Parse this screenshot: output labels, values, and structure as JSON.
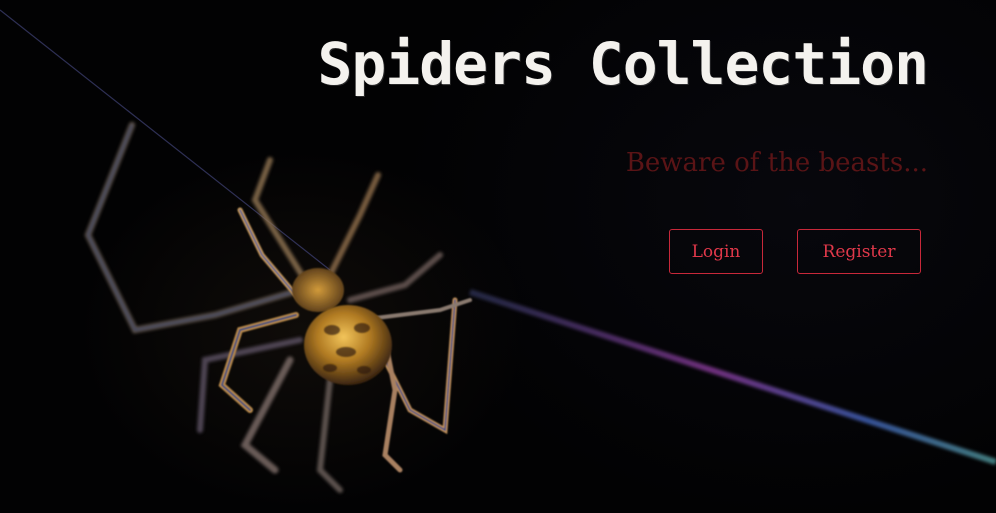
{
  "hero": {
    "title": "Spiders Collection",
    "subtitle": "Beware of the beasts...",
    "background_image": "spider-on-web-photo"
  },
  "actions": {
    "login_label": "Login",
    "register_label": "Register"
  },
  "colors": {
    "background": "#020203",
    "title": "#f4f2ee",
    "subtitle": "#5a1416",
    "button_border": "#c8283a",
    "button_text": "#e0384a"
  }
}
